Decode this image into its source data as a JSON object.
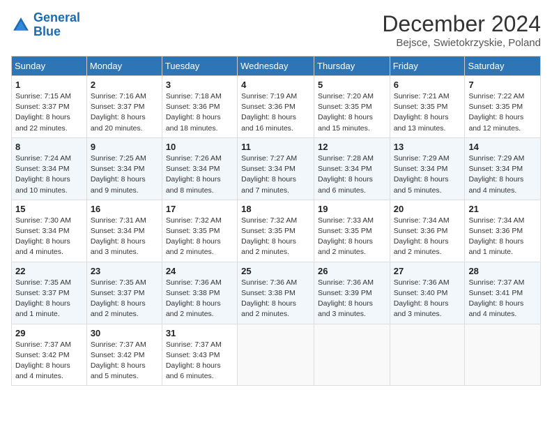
{
  "logo": {
    "line1": "General",
    "line2": "Blue"
  },
  "title": "December 2024",
  "location": "Bejsce, Swietokrzyskie, Poland",
  "days_of_week": [
    "Sunday",
    "Monday",
    "Tuesday",
    "Wednesday",
    "Thursday",
    "Friday",
    "Saturday"
  ],
  "weeks": [
    [
      {
        "day": "1",
        "info": "Sunrise: 7:15 AM\nSunset: 3:37 PM\nDaylight: 8 hours\nand 22 minutes."
      },
      {
        "day": "2",
        "info": "Sunrise: 7:16 AM\nSunset: 3:37 PM\nDaylight: 8 hours\nand 20 minutes."
      },
      {
        "day": "3",
        "info": "Sunrise: 7:18 AM\nSunset: 3:36 PM\nDaylight: 8 hours\nand 18 minutes."
      },
      {
        "day": "4",
        "info": "Sunrise: 7:19 AM\nSunset: 3:36 PM\nDaylight: 8 hours\nand 16 minutes."
      },
      {
        "day": "5",
        "info": "Sunrise: 7:20 AM\nSunset: 3:35 PM\nDaylight: 8 hours\nand 15 minutes."
      },
      {
        "day": "6",
        "info": "Sunrise: 7:21 AM\nSunset: 3:35 PM\nDaylight: 8 hours\nand 13 minutes."
      },
      {
        "day": "7",
        "info": "Sunrise: 7:22 AM\nSunset: 3:35 PM\nDaylight: 8 hours\nand 12 minutes."
      }
    ],
    [
      {
        "day": "8",
        "info": "Sunrise: 7:24 AM\nSunset: 3:34 PM\nDaylight: 8 hours\nand 10 minutes."
      },
      {
        "day": "9",
        "info": "Sunrise: 7:25 AM\nSunset: 3:34 PM\nDaylight: 8 hours\nand 9 minutes."
      },
      {
        "day": "10",
        "info": "Sunrise: 7:26 AM\nSunset: 3:34 PM\nDaylight: 8 hours\nand 8 minutes."
      },
      {
        "day": "11",
        "info": "Sunrise: 7:27 AM\nSunset: 3:34 PM\nDaylight: 8 hours\nand 7 minutes."
      },
      {
        "day": "12",
        "info": "Sunrise: 7:28 AM\nSunset: 3:34 PM\nDaylight: 8 hours\nand 6 minutes."
      },
      {
        "day": "13",
        "info": "Sunrise: 7:29 AM\nSunset: 3:34 PM\nDaylight: 8 hours\nand 5 minutes."
      },
      {
        "day": "14",
        "info": "Sunrise: 7:29 AM\nSunset: 3:34 PM\nDaylight: 8 hours\nand 4 minutes."
      }
    ],
    [
      {
        "day": "15",
        "info": "Sunrise: 7:30 AM\nSunset: 3:34 PM\nDaylight: 8 hours\nand 4 minutes."
      },
      {
        "day": "16",
        "info": "Sunrise: 7:31 AM\nSunset: 3:34 PM\nDaylight: 8 hours\nand 3 minutes."
      },
      {
        "day": "17",
        "info": "Sunrise: 7:32 AM\nSunset: 3:35 PM\nDaylight: 8 hours\nand 2 minutes."
      },
      {
        "day": "18",
        "info": "Sunrise: 7:32 AM\nSunset: 3:35 PM\nDaylight: 8 hours\nand 2 minutes."
      },
      {
        "day": "19",
        "info": "Sunrise: 7:33 AM\nSunset: 3:35 PM\nDaylight: 8 hours\nand 2 minutes."
      },
      {
        "day": "20",
        "info": "Sunrise: 7:34 AM\nSunset: 3:36 PM\nDaylight: 8 hours\nand 2 minutes."
      },
      {
        "day": "21",
        "info": "Sunrise: 7:34 AM\nSunset: 3:36 PM\nDaylight: 8 hours\nand 1 minute."
      }
    ],
    [
      {
        "day": "22",
        "info": "Sunrise: 7:35 AM\nSunset: 3:37 PM\nDaylight: 8 hours\nand 1 minute."
      },
      {
        "day": "23",
        "info": "Sunrise: 7:35 AM\nSunset: 3:37 PM\nDaylight: 8 hours\nand 2 minutes."
      },
      {
        "day": "24",
        "info": "Sunrise: 7:36 AM\nSunset: 3:38 PM\nDaylight: 8 hours\nand 2 minutes."
      },
      {
        "day": "25",
        "info": "Sunrise: 7:36 AM\nSunset: 3:38 PM\nDaylight: 8 hours\nand 2 minutes."
      },
      {
        "day": "26",
        "info": "Sunrise: 7:36 AM\nSunset: 3:39 PM\nDaylight: 8 hours\nand 3 minutes."
      },
      {
        "day": "27",
        "info": "Sunrise: 7:36 AM\nSunset: 3:40 PM\nDaylight: 8 hours\nand 3 minutes."
      },
      {
        "day": "28",
        "info": "Sunrise: 7:37 AM\nSunset: 3:41 PM\nDaylight: 8 hours\nand 4 minutes."
      }
    ],
    [
      {
        "day": "29",
        "info": "Sunrise: 7:37 AM\nSunset: 3:42 PM\nDaylight: 8 hours\nand 4 minutes."
      },
      {
        "day": "30",
        "info": "Sunrise: 7:37 AM\nSunset: 3:42 PM\nDaylight: 8 hours\nand 5 minutes."
      },
      {
        "day": "31",
        "info": "Sunrise: 7:37 AM\nSunset: 3:43 PM\nDaylight: 8 hours\nand 6 minutes."
      },
      {
        "day": "",
        "info": ""
      },
      {
        "day": "",
        "info": ""
      },
      {
        "day": "",
        "info": ""
      },
      {
        "day": "",
        "info": ""
      }
    ]
  ]
}
